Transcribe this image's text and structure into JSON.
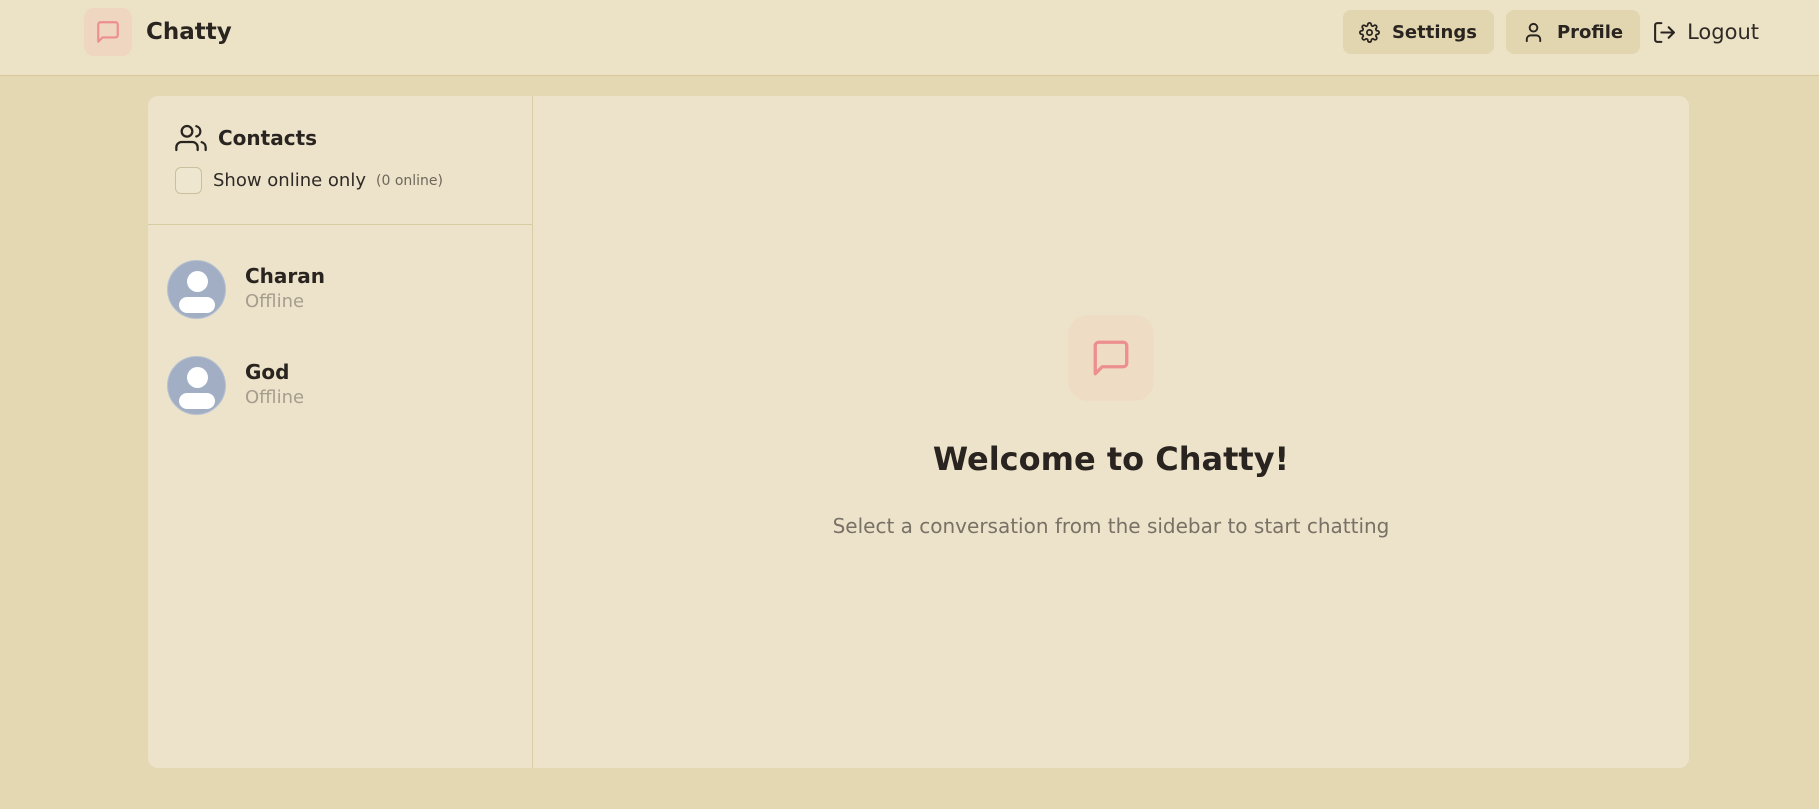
{
  "header": {
    "app_name": "Chatty",
    "logo_icon": "message-square-icon",
    "nav": {
      "settings_label": "Settings",
      "profile_label": "Profile",
      "logout_label": "Logout"
    }
  },
  "sidebar": {
    "title": "Contacts",
    "filter_label": "Show online only",
    "online_count": "(0 online)",
    "show_online_checked": false,
    "contacts": [
      {
        "name": "Charan",
        "status": "Offline"
      },
      {
        "name": "God",
        "status": "Offline"
      }
    ]
  },
  "welcome": {
    "title": "Welcome to Chatty!",
    "subtitle": "Select a conversation from the sidebar to start chatting"
  },
  "colors": {
    "background": "#e4d8b3",
    "header": "#ece3c7",
    "card": "#ece3ca",
    "accent": "#ee8f8f",
    "button": "#e2d6b0"
  }
}
